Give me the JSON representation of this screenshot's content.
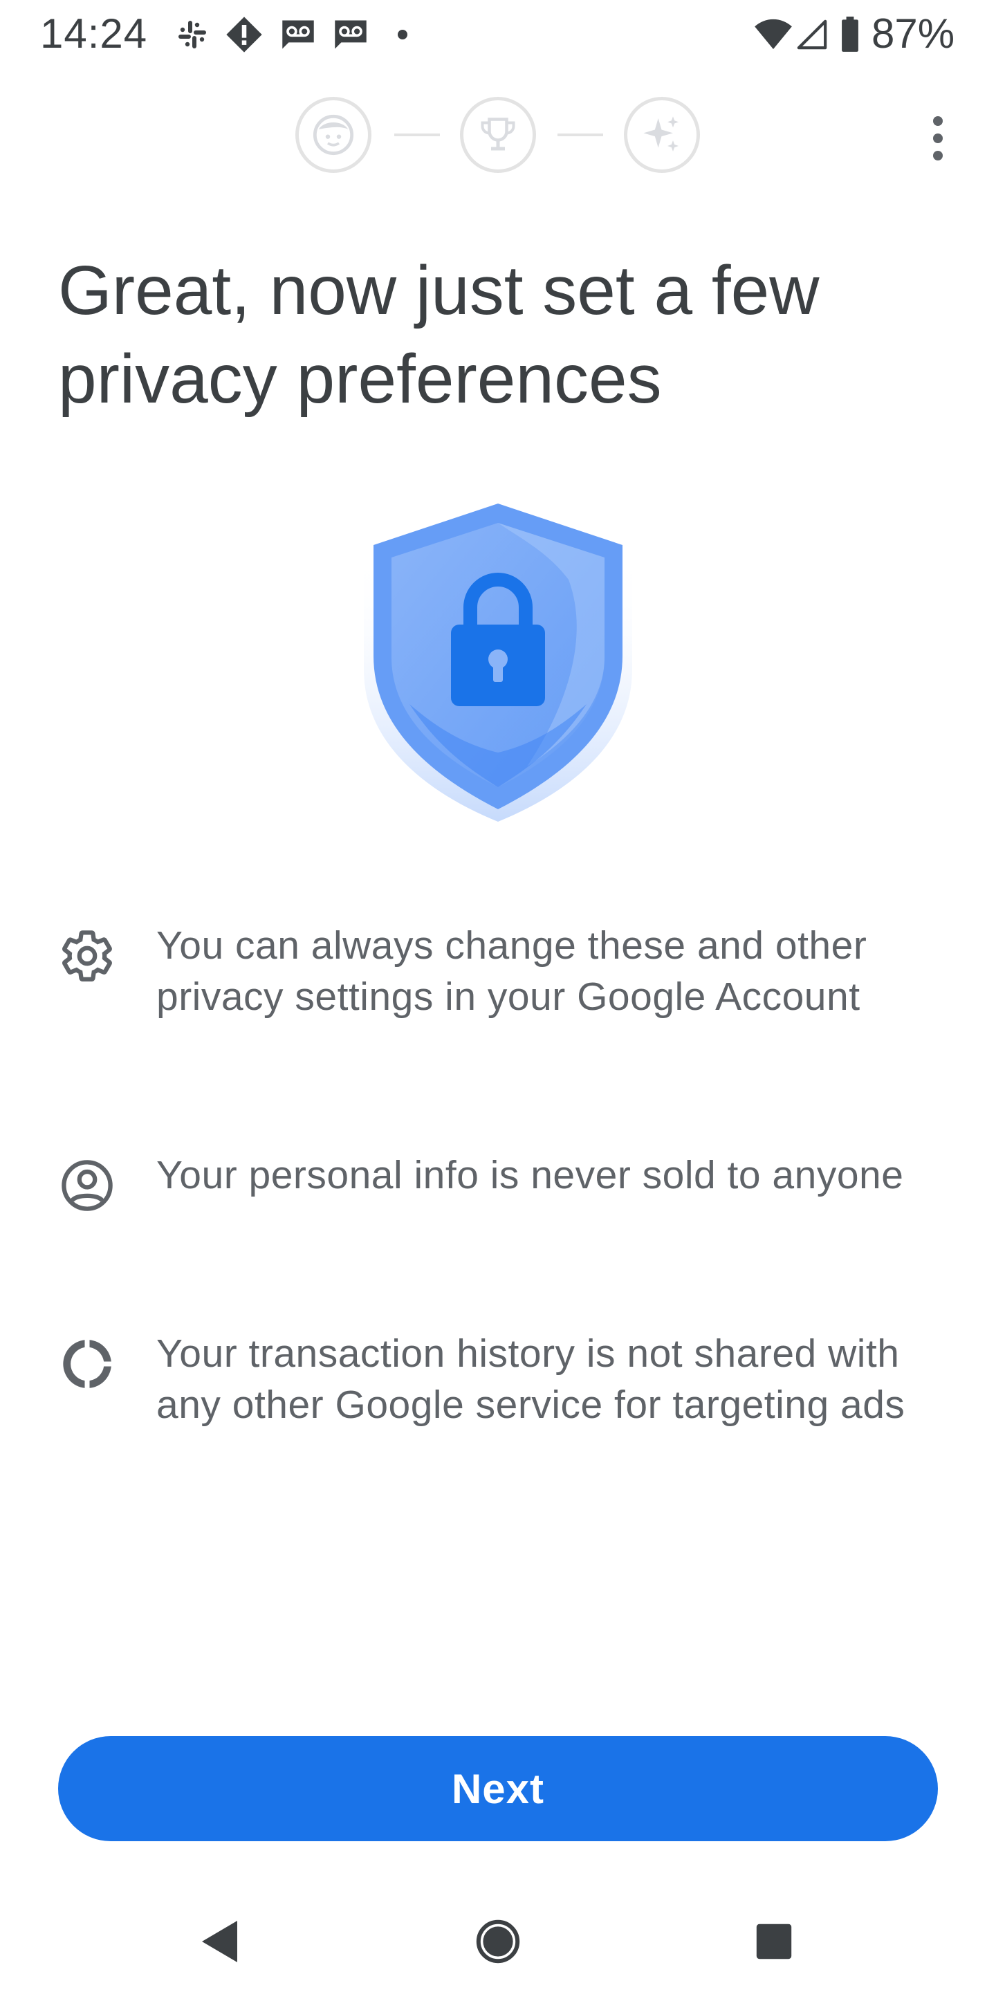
{
  "status_bar": {
    "time": "14:24",
    "battery": "87%",
    "icons": [
      "slack-icon",
      "alert-icon",
      "voicemail-icon",
      "voicemail-icon",
      "dot-icon",
      "wifi-icon",
      "signal-icon",
      "battery-icon"
    ]
  },
  "progress": {
    "steps": [
      "face-icon",
      "trophy-icon",
      "sparkle-icon"
    ]
  },
  "title": "Great, now just set a few privacy preferences",
  "hero_icon": "shield-lock-icon",
  "items": [
    {
      "icon": "gear-icon",
      "text": "You can always change these and other privacy settings in your Google Account"
    },
    {
      "icon": "account-circle-icon",
      "text": "Your personal info is never sold to anyone"
    },
    {
      "icon": "donut-icon",
      "text": "Your transaction history is not shared with any other Google service for targeting ads"
    }
  ],
  "next_label": "Next",
  "colors": {
    "primary": "#1a73e8",
    "text": "#3c4043",
    "secondary_text": "#5f6368",
    "shield": "#669df6"
  }
}
